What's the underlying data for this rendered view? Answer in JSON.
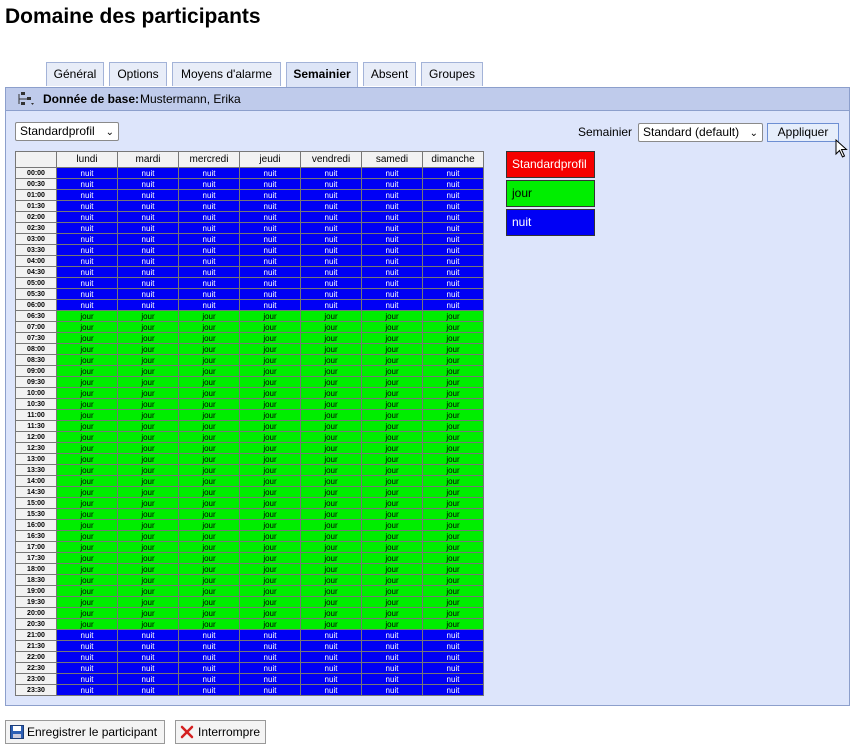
{
  "page": {
    "title": "Domaine des participants"
  },
  "tabs": [
    {
      "label": "Général",
      "active": false
    },
    {
      "label": "Options",
      "active": false
    },
    {
      "label": "Moyens d'alarme",
      "active": false
    },
    {
      "label": "Semainier",
      "active": true
    },
    {
      "label": "Absent",
      "active": false
    },
    {
      "label": "Groupes",
      "active": false
    }
  ],
  "header": {
    "label": "Donnée de base:",
    "value": "Mustermann, Erika"
  },
  "toolbar": {
    "profile_select": "Standardprofil",
    "semainier_label": "Semainier",
    "semainier_select": "Standard (default)",
    "apply_label": "Appliquer"
  },
  "schedule": {
    "days": [
      "lundi",
      "mardi",
      "mercredi",
      "jeudi",
      "vendredi",
      "samedi",
      "dimanche"
    ],
    "times": [
      "00:00",
      "00:30",
      "01:00",
      "01:30",
      "02:00",
      "02:30",
      "03:00",
      "03:30",
      "04:00",
      "04:30",
      "05:00",
      "05:30",
      "06:00",
      "06:30",
      "07:00",
      "07:30",
      "08:00",
      "08:30",
      "09:00",
      "09:30",
      "10:00",
      "10:30",
      "11:00",
      "11:30",
      "12:00",
      "12:30",
      "13:00",
      "13:30",
      "14:00",
      "14:30",
      "15:00",
      "15:30",
      "16:00",
      "16:30",
      "17:00",
      "17:30",
      "18:00",
      "18:30",
      "19:00",
      "19:30",
      "20:00",
      "20:30",
      "21:00",
      "21:30",
      "22:00",
      "22:30",
      "23:00",
      "23:30"
    ],
    "jour_from": "06:30",
    "jour_until": "20:30",
    "profiles": {
      "nuit": {
        "label": "nuit",
        "color": "#0000f5"
      },
      "jour": {
        "label": "jour",
        "color": "#00ee00"
      }
    }
  },
  "legend": [
    {
      "label": "Standardprofil",
      "color": "#f50000",
      "text_color": "#ffffff"
    },
    {
      "label": "jour",
      "color": "#00ee00",
      "text_color": "#000000"
    },
    {
      "label": "nuit",
      "color": "#0000f5",
      "text_color": "#ffffff"
    }
  ],
  "footer": {
    "save_label": "Enregistrer le participant",
    "cancel_label": "Interrompre"
  }
}
